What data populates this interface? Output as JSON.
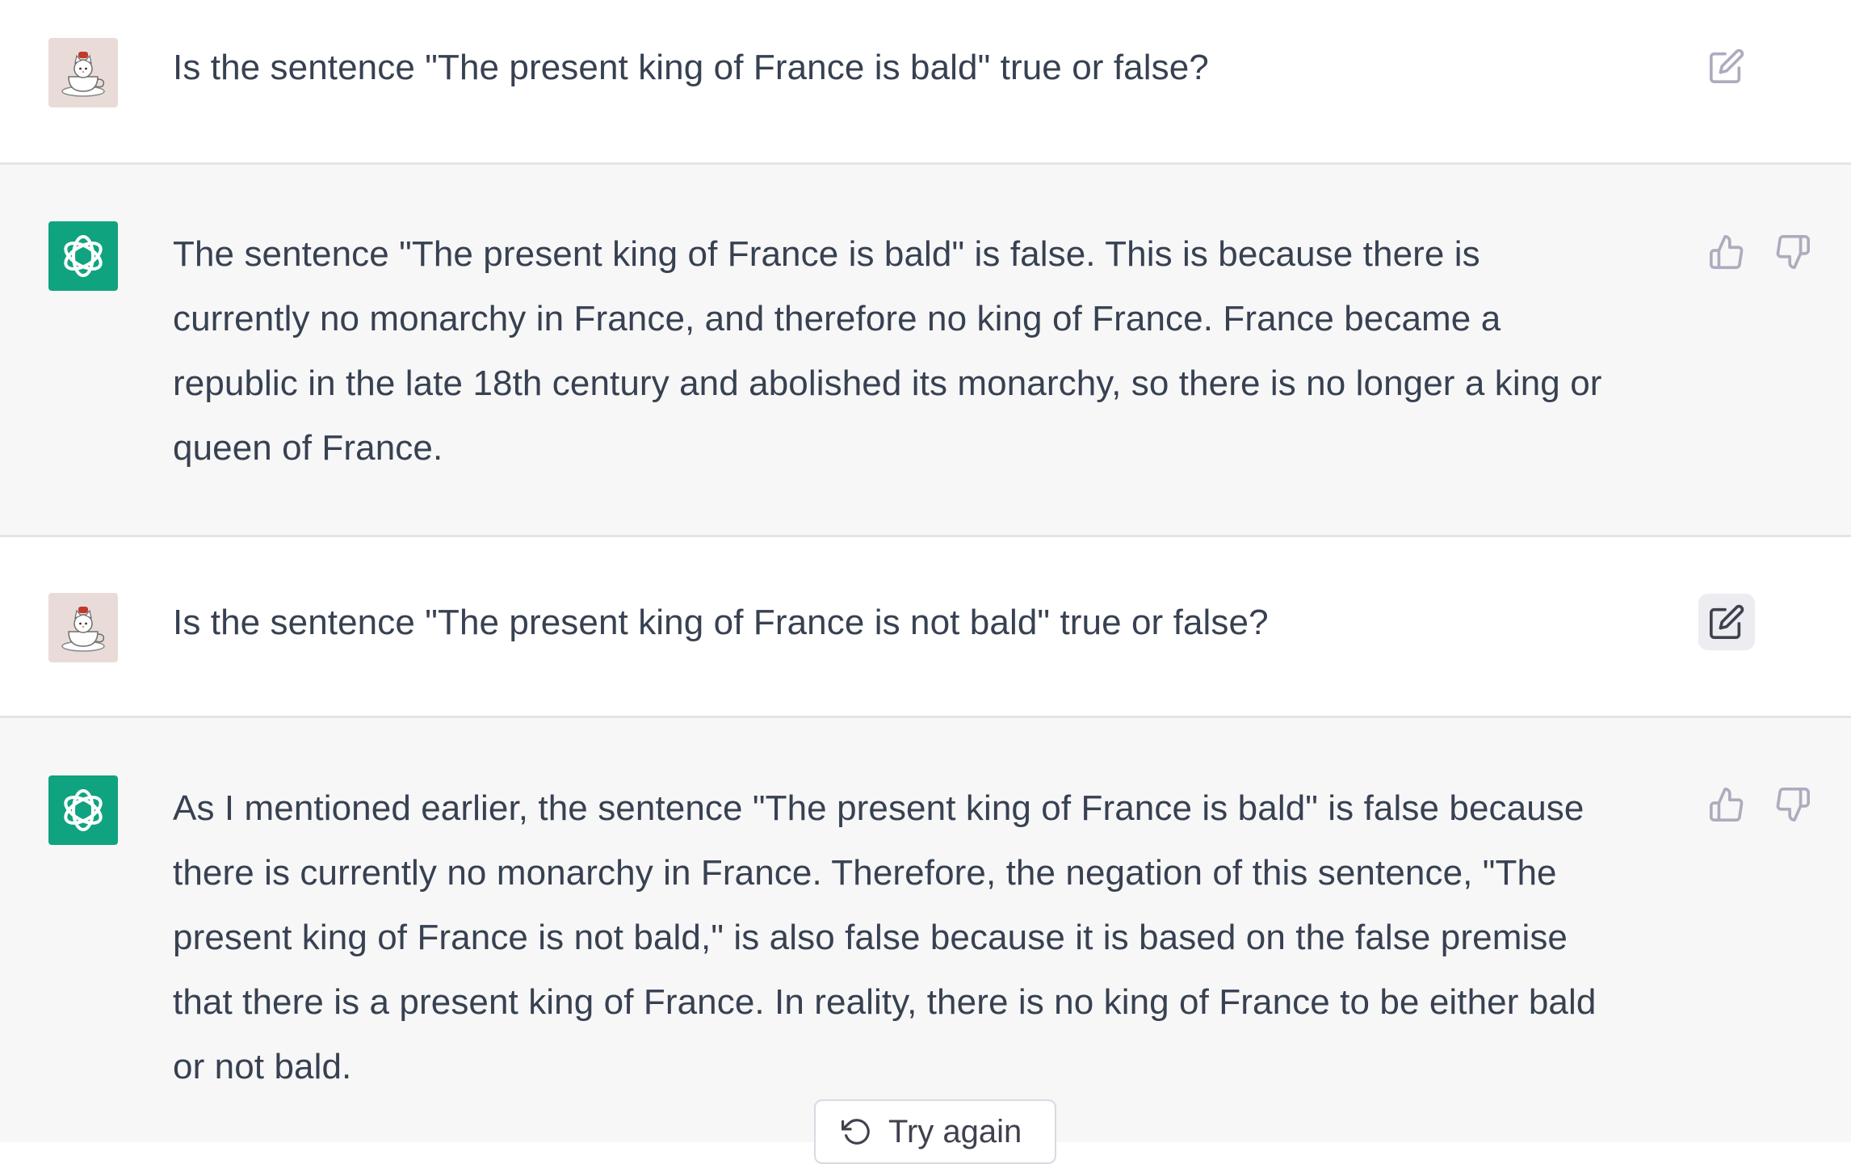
{
  "conversation": {
    "messages": [
      {
        "role": "user",
        "text": "Is the sentence \"The present king of France is bald\" true or false?",
        "action_icon": "edit-icon"
      },
      {
        "role": "assistant",
        "lines": [
          "The sentence \"The present king of France is bald\" is false. This is because there is",
          "currently no monarchy in France, and therefore no king of France. France became a",
          "republic in the late 18th century and abolished its monarchy, so there is no longer a king or",
          "queen of France."
        ],
        "action_icons": [
          "thumbs-up-icon",
          "thumbs-down-icon"
        ]
      },
      {
        "role": "user",
        "text": "Is the sentence \"The present king of France is not bald\" true or false?",
        "action_icon": "edit-icon"
      },
      {
        "role": "assistant",
        "lines": [
          "As I mentioned earlier, the sentence \"The present king of France is bald\" is false because",
          "there is currently no monarchy in France. Therefore, the negation of this sentence, \"The",
          "present king of France is not bald,\" is also false because it is based on the false premise",
          "that there is a present king of France. In reality, there is no king of France to be either bald",
          "or not bald."
        ],
        "action_icons": [
          "thumbs-up-icon",
          "thumbs-down-icon"
        ]
      }
    ]
  },
  "footer": {
    "try_again_label": "Try again",
    "try_again_icon": "refresh-icon"
  },
  "colors": {
    "assistant_bg": "#f7f7f8",
    "user_bg": "#ffffff",
    "gpt_avatar": "#10a37f",
    "text": "#374151",
    "icon": "#acacbe"
  }
}
